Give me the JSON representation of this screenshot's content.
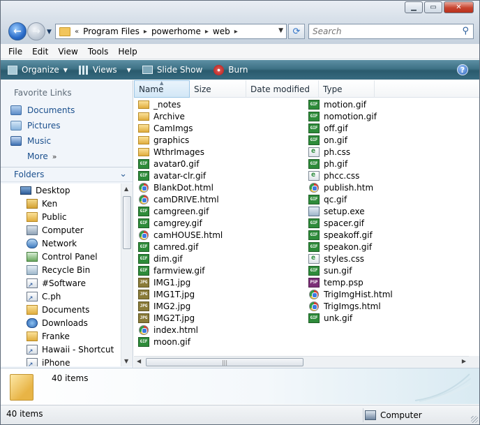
{
  "address": {
    "crumbs": [
      "Program Files",
      "powerhome",
      "web"
    ]
  },
  "search": {
    "placeholder": "Search"
  },
  "menu": [
    "File",
    "Edit",
    "View",
    "Tools",
    "Help"
  ],
  "toolbar": {
    "organize": "Organize",
    "views": "Views",
    "slideshow": "Slide Show",
    "burn": "Burn",
    "help": "?"
  },
  "favorites": {
    "title": "Favorite Links",
    "items": [
      "Documents",
      "Pictures",
      "Music"
    ],
    "more": "More"
  },
  "folders": {
    "title": "Folders",
    "tree": [
      {
        "label": "Desktop",
        "icon": "desktop-icon"
      },
      {
        "label": "Ken",
        "icon": "user-folder-icon"
      },
      {
        "label": "Public",
        "icon": "public-folder-icon"
      },
      {
        "label": "Computer",
        "icon": "computer-icon"
      },
      {
        "label": "Network",
        "icon": "network-icon"
      },
      {
        "label": "Control Panel",
        "icon": "control-panel-icon"
      },
      {
        "label": "Recycle Bin",
        "icon": "recycle-bin-icon"
      },
      {
        "label": "#Software",
        "icon": "shortcut-icon"
      },
      {
        "label": "C.ph",
        "icon": "shortcut-icon"
      },
      {
        "label": "Documents",
        "icon": "folder-icon"
      },
      {
        "label": "Downloads",
        "icon": "downloads-icon"
      },
      {
        "label": "Franke",
        "icon": "folder-icon"
      },
      {
        "label": "Hawaii - Shortcut",
        "icon": "shortcut-icon"
      },
      {
        "label": "iPhone",
        "icon": "shortcut-icon"
      }
    ]
  },
  "columns": [
    "Name",
    "Size",
    "Date modified",
    "Type"
  ],
  "files_col1": [
    {
      "name": "_notes",
      "type": "folder"
    },
    {
      "name": "Archive",
      "type": "folder"
    },
    {
      "name": "CamImgs",
      "type": "folder"
    },
    {
      "name": "graphics",
      "type": "folder"
    },
    {
      "name": "WthrImages",
      "type": "folder"
    },
    {
      "name": "avatar0.gif",
      "type": "gif"
    },
    {
      "name": "avatar-clr.gif",
      "type": "gif"
    },
    {
      "name": "BlankDot.html",
      "type": "html"
    },
    {
      "name": "camDRIVE.html",
      "type": "html"
    },
    {
      "name": "camgreen.gif",
      "type": "gif"
    },
    {
      "name": "camgrey.gif",
      "type": "gif"
    },
    {
      "name": "camHOUSE.html",
      "type": "html"
    },
    {
      "name": "camred.gif",
      "type": "gif"
    },
    {
      "name": "dim.gif",
      "type": "gif"
    },
    {
      "name": "farmview.gif",
      "type": "gif"
    },
    {
      "name": "IMG1.jpg",
      "type": "jpg"
    },
    {
      "name": "IMG1T.jpg",
      "type": "jpg"
    },
    {
      "name": "IMG2.jpg",
      "type": "jpg"
    },
    {
      "name": "IMG2T.jpg",
      "type": "jpg"
    },
    {
      "name": "index.html",
      "type": "html"
    },
    {
      "name": "moon.gif",
      "type": "gif"
    }
  ],
  "files_col2": [
    {
      "name": "motion.gif",
      "type": "gif"
    },
    {
      "name": "nomotion.gif",
      "type": "gif"
    },
    {
      "name": "off.gif",
      "type": "gif"
    },
    {
      "name": "on.gif",
      "type": "gif"
    },
    {
      "name": "ph.css",
      "type": "css"
    },
    {
      "name": "ph.gif",
      "type": "gif"
    },
    {
      "name": "phcc.css",
      "type": "css"
    },
    {
      "name": "publish.htm",
      "type": "html"
    },
    {
      "name": "qc.gif",
      "type": "gif"
    },
    {
      "name": "setup.exe",
      "type": "exe"
    },
    {
      "name": "spacer.gif",
      "type": "gif"
    },
    {
      "name": "speakoff.gif",
      "type": "gif"
    },
    {
      "name": "speakon.gif",
      "type": "gif"
    },
    {
      "name": "styles.css",
      "type": "css"
    },
    {
      "name": "sun.gif",
      "type": "gif"
    },
    {
      "name": "temp.psp",
      "type": "psp"
    },
    {
      "name": "TrigImgHist.html",
      "type": "html"
    },
    {
      "name": "TrigImgs.html",
      "type": "html"
    },
    {
      "name": "unk.gif",
      "type": "gif"
    }
  ],
  "details": {
    "count": "40 items"
  },
  "status": {
    "left": "40 items",
    "right": "Computer"
  }
}
